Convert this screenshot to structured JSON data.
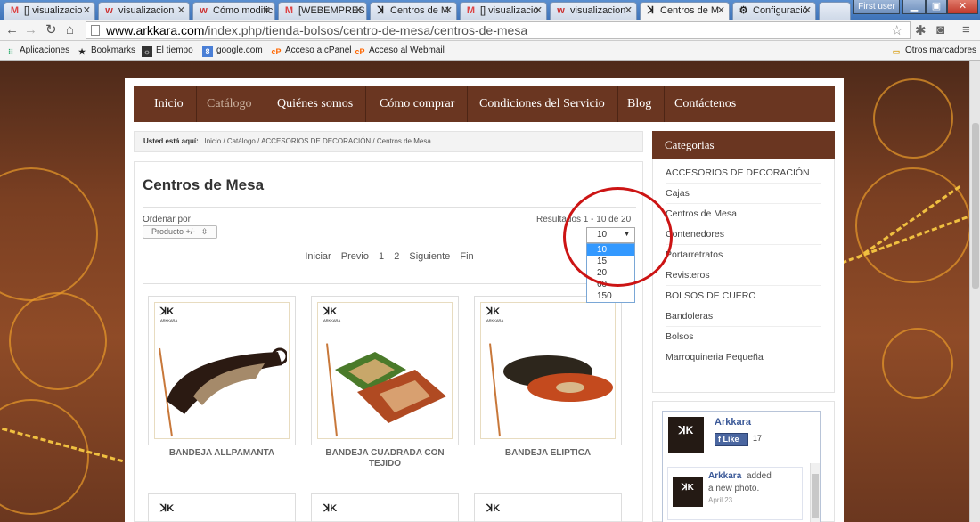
{
  "browser": {
    "tabs": [
      {
        "icon": "M",
        "title": "[] visualizacio"
      },
      {
        "icon": "w",
        "title": "visualizacion"
      },
      {
        "icon": "w",
        "title": "Cómo modific"
      },
      {
        "icon": "M",
        "title": "[WEBEMPRES"
      },
      {
        "icon": "ꓘ",
        "title": "Centros de M"
      },
      {
        "icon": "M",
        "title": "[] visualizacio"
      },
      {
        "icon": "w",
        "title": "visualizacion"
      },
      {
        "icon": "ꓘ",
        "title": "Centros de M"
      },
      {
        "icon": "⚙",
        "title": "Configuració"
      }
    ],
    "user_label": "First user",
    "url_host": "www.arkkara.com",
    "url_path": "/index.php/tienda-bolsos/centro-de-mesa/centros-de-mesa",
    "bookmarks": [
      "Aplicaciones",
      "Bookmarks",
      "El tiempo",
      "google.com",
      "Acceso a cPanel",
      "Acceso al Webmail"
    ],
    "other_bookmarks": "Otros marcadores"
  },
  "nav": {
    "items": [
      "Inicio",
      "Catálogo",
      "Quiénes somos",
      "Cómo comprar",
      "Condiciones del Servicio",
      "Blog",
      "Contáctenos"
    ]
  },
  "breadcrumb": {
    "label": "Usted está aquí:",
    "path": "Inicio  /  Catálogo  /  ACCESORIOS DE DECORACIÓN  /  Centros de Mesa"
  },
  "listing": {
    "title": "Centros de Mesa",
    "order_label": "Ordenar por",
    "order_value": "Producto +/-",
    "results": "Resultados 1 - 10 de 20",
    "limit_value": "10",
    "limit_options": [
      "10",
      "15",
      "20",
      "60",
      "150"
    ],
    "pager": [
      "Iniciar",
      "Previo",
      "1",
      "2",
      "Siguiente",
      "Fin"
    ],
    "products": [
      "BANDEJA ALLPAMANTA",
      "BANDEJA CUADRADA CON TEJIDO",
      "BANDEJA ELIPTICA"
    ]
  },
  "categories": {
    "header": "Categorias",
    "items": [
      "ACCESORIOS DE DECORACIÓN",
      "Cajas",
      "Centros de Mesa",
      "Contenedores",
      "Portarretratos",
      "Revisteros",
      "BOLSOS DE CUERO",
      "Bandoleras",
      "Bolsos",
      "Marroquineria Pequeña"
    ]
  },
  "facebook": {
    "page_name": "Arkkara",
    "like_label": "Like",
    "like_count": "17",
    "post_author": "Arkkara",
    "post_action": "added",
    "post_text": "a new photo.",
    "post_date": "April 23"
  },
  "brand": {
    "logo_text": "ꓘK",
    "logo_sub": "ARKKARA"
  },
  "colors": {
    "nav_bg": "#6a3621",
    "highlight": "#cc1414",
    "selected_option": "#3399ff"
  }
}
